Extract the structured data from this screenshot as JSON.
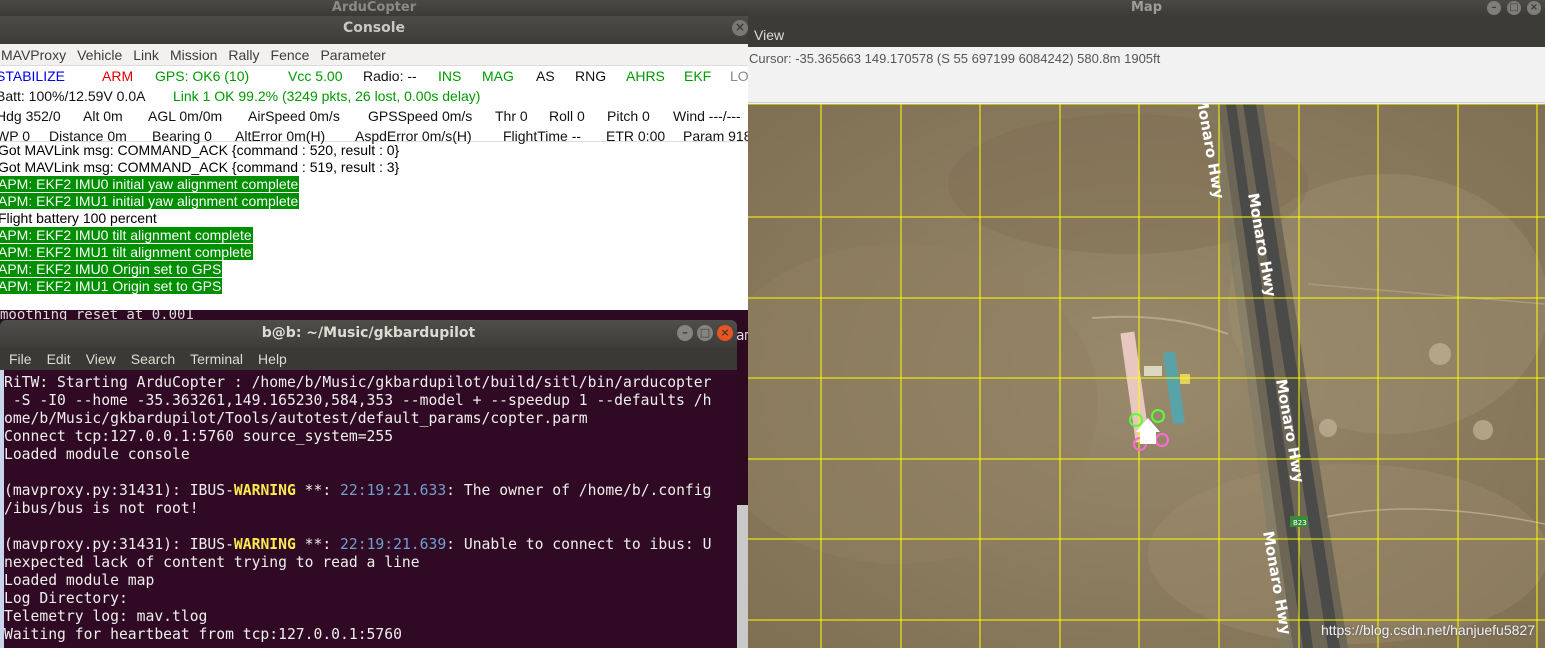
{
  "arducopter_window": {
    "title": "ArduCopter"
  },
  "console": {
    "title": "Console",
    "close_glyph": "×",
    "menu": [
      "MAVProxy",
      "Vehicle",
      "Link",
      "Mission",
      "Rally",
      "Fence",
      "Parameter"
    ],
    "status1": {
      "mode": "STABILIZE",
      "arm": "ARM",
      "gps": "GPS: OK6 (10)",
      "vcc": "Vcc 5.00",
      "radio": "Radio: --",
      "ins": "INS",
      "mag": "MAG",
      "as": "AS",
      "rng": "RNG",
      "ahrs": "AHRS",
      "ekf": "EKF",
      "lo": "LO"
    },
    "status2": {
      "batt": "Batt: 100%/12.59V 0.0A",
      "link": "Link 1 OK 99.2% (3249 pkts, 26 lost, 0.00s delay)"
    },
    "status3": {
      "hdg": "Hdg 352/0",
      "alt": "Alt 0m",
      "agl": "AGL 0m/0m",
      "airspeed": "AirSpeed 0m/s",
      "gpsspeed": "GPSSpeed 0m/s",
      "thr": "Thr 0",
      "roll": "Roll 0",
      "pitch": "Pitch 0",
      "wind": "Wind ---/---"
    },
    "status4": {
      "wp": "WP 0",
      "distance": "Distance 0m",
      "bearing": "Bearing 0",
      "alterror": "AltError 0m(H)",
      "aspderror": "AspdError 0m/s(H)",
      "flighttime": "FlightTime --",
      "etr": "ETR 0:00",
      "param": "Param 918"
    },
    "log": [
      {
        "text": "Got MAVLink msg: COMMAND_ACK {command : 520, result : 0}",
        "highlight": false
      },
      {
        "text": "Got MAVLink msg: COMMAND_ACK {command : 519, result : 3}",
        "highlight": false
      },
      {
        "text": "APM: EKF2 IMU0 initial yaw alignment complete",
        "highlight": true
      },
      {
        "text": "APM: EKF2 IMU1 initial yaw alignment complete",
        "highlight": true
      },
      {
        "text": "Flight battery 100 percent",
        "highlight": false
      },
      {
        "text": "APM: EKF2 IMU0 tilt alignment complete",
        "highlight": true
      },
      {
        "text": "APM: EKF2 IMU1 tilt alignment complete",
        "highlight": true
      },
      {
        "text": "APM: EKF2 IMU0 Origin set to GPS",
        "highlight": true
      },
      {
        "text": "APM: EKF2 IMU1 Origin set to GPS",
        "highlight": true
      }
    ],
    "highlight_color": "#008f00"
  },
  "background_terminal": {
    "peek_text": "moothing reset at 0.001",
    "peek_right": "am"
  },
  "terminal": {
    "title": "b@b: ~/Music/gkbardupilot",
    "buttons": {
      "min": "–",
      "max": "□",
      "close": "×"
    },
    "menu": [
      "File",
      "Edit",
      "View",
      "Search",
      "Terminal",
      "Help"
    ],
    "lines": [
      "RiTW: Starting ArduCopter : /home/b/Music/gkbardupilot/build/sitl/bin/arducopter",
      " -S -I0 --home -35.363261,149.165230,584,353 --model + --speedup 1 --defaults /h",
      "ome/b/Music/gkbardupilot/Tools/autotest/default_params/copter.parm",
      "Connect tcp:127.0.0.1:5760 source_system=255",
      "Loaded module console",
      "",
      "",
      "",
      "",
      "",
      "nexpected lack of content trying to read a line",
      "Loaded module map",
      "Log Directory:",
      "Telemetry log: mav.tlog",
      "Waiting for heartbeat from tcp:127.0.0.1:5760"
    ],
    "warn1": {
      "prefix": "(mavproxy.py:31431): IBUS-",
      "level": "WARNING",
      "mid": " **: ",
      "time": "22:19:21.633",
      "msg": ": The owner of /home/b/.config"
    },
    "warn1_cont": "/ibus/bus is not root!",
    "warn2": {
      "prefix": "(mavproxy.py:31431): IBUS-",
      "level": "WARNING",
      "mid": " **: ",
      "time": "22:19:21.639",
      "msg": ": Unable to connect to ibus: U"
    }
  },
  "map": {
    "title": "Map",
    "view_menu": "View",
    "cursor": "Cursor: -35.365663 149.170578 (S 55 697199 6084242) 580.8m 1905ft",
    "road_labels": [
      "Monaro Hwy",
      "Monaro Hwy",
      "Monaro Hwy",
      "Monaro Hwy",
      "Monaro Hwy"
    ],
    "road_shield": "B23",
    "grid_color": "#ffff00",
    "watermark": "https://blog.csdn.net/hanjuefu5827"
  }
}
